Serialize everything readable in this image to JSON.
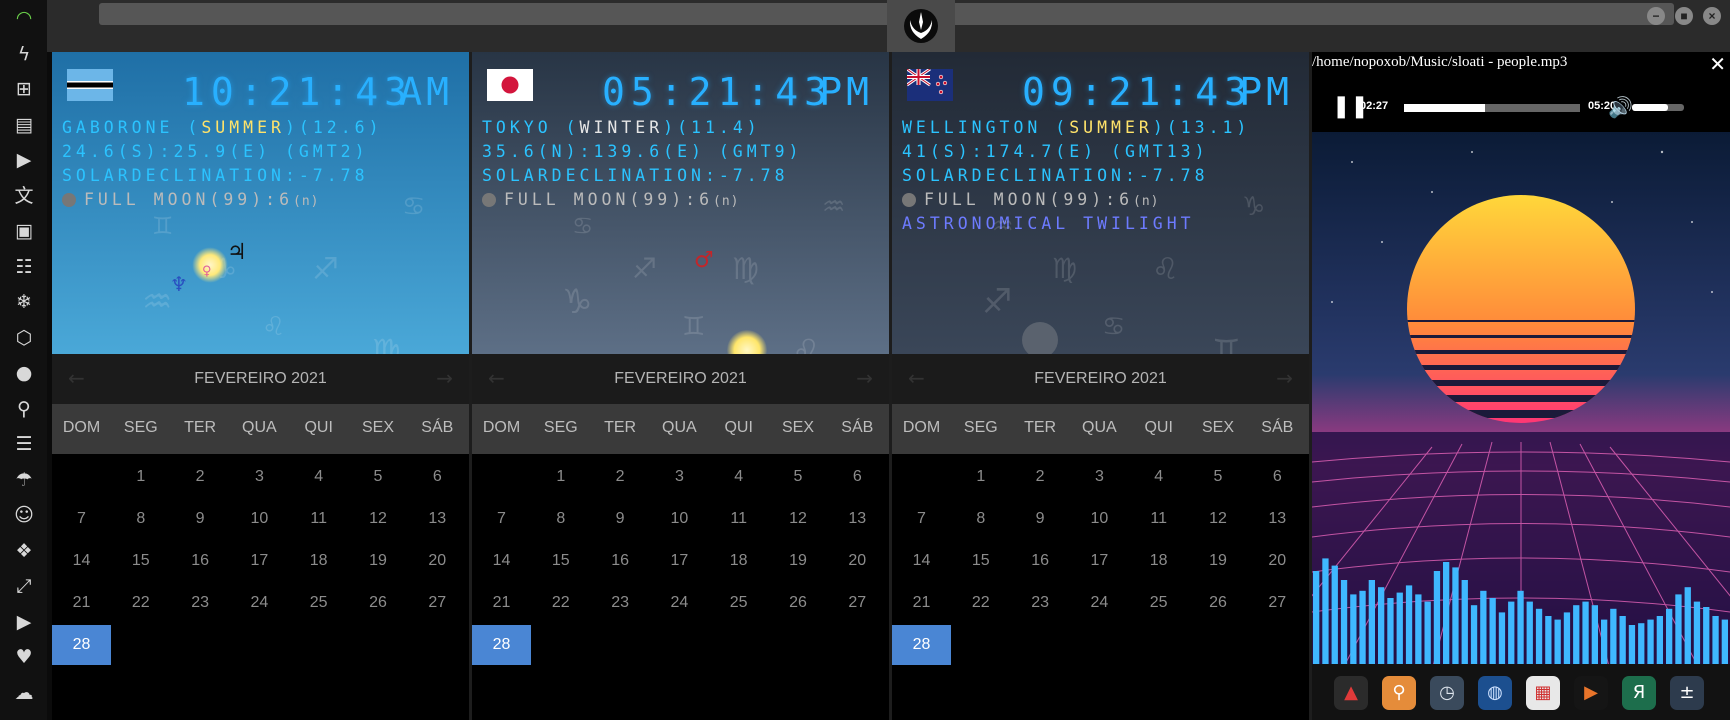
{
  "dock": {
    "items": [
      {
        "icon": "wifi-icon",
        "glyph": "◠"
      },
      {
        "icon": "lightning-icon",
        "glyph": "ϟ"
      },
      {
        "icon": "windows-icon",
        "glyph": "⊞"
      },
      {
        "icon": "archive-icon",
        "glyph": "▤"
      },
      {
        "icon": "play-circle-icon",
        "glyph": "▶"
      },
      {
        "icon": "translate-icon",
        "glyph": "文"
      },
      {
        "icon": "image-icon",
        "glyph": "▣"
      },
      {
        "icon": "news-icon",
        "glyph": "☷"
      },
      {
        "icon": "snowflake-icon",
        "glyph": "❄"
      },
      {
        "icon": "hexagon-icon",
        "glyph": "⬡"
      },
      {
        "icon": "globe-icon",
        "glyph": "●"
      },
      {
        "icon": "search-icon",
        "glyph": "⚲"
      },
      {
        "icon": "map-icon",
        "glyph": "☰"
      },
      {
        "icon": "umbrella-icon",
        "glyph": "☂"
      },
      {
        "icon": "contacts-icon",
        "glyph": "☺"
      },
      {
        "icon": "code-icon",
        "glyph": "❖"
      },
      {
        "icon": "fullscreen-icon",
        "glyph": "⤢"
      },
      {
        "icon": "youtube-icon",
        "glyph": "▶"
      },
      {
        "icon": "heart-icon",
        "glyph": "♥"
      },
      {
        "icon": "cloud-icon",
        "glyph": "☁"
      }
    ]
  },
  "window": {
    "buttons": [
      {
        "name": "minimize-button",
        "glyph": "−"
      },
      {
        "name": "maximize-button",
        "glyph": "■"
      },
      {
        "name": "close-button",
        "glyph": "×"
      }
    ]
  },
  "clocks": [
    {
      "flag": "botswana",
      "time": "10:21:43",
      "ampm": "AM",
      "city": "GABORONE",
      "season": "SUMMER",
      "season_color": "yellow",
      "day_len": "(12.6)",
      "coords": "24.6(S):25.9(E) (GMT2)",
      "solar": "SOLARDECLINATION:-7.78",
      "moon": "FULL MOON(99):6",
      "moon_suffix": "(n)",
      "twilight": "",
      "sky_top": "#1f6fa6",
      "sky_bottom": "#4aa8d8"
    },
    {
      "flag": "japan",
      "time": "05:21:43",
      "ampm": "PM",
      "city": "TOKYO",
      "season": "WINTER",
      "season_color": "white",
      "day_len": "(11.4)",
      "coords": "35.6(N):139.6(E) (GMT9)",
      "solar": "SOLARDECLINATION:-7.78",
      "moon": "FULL MOON(99):6",
      "moon_suffix": "(n)",
      "twilight": "",
      "sky_top": "#283545",
      "sky_bottom": "#5d6f86"
    },
    {
      "flag": "new-zealand",
      "time": "09:21:43",
      "ampm": "PM",
      "city": "WELLINGTON",
      "season": "SUMMER",
      "season_color": "yellow",
      "day_len": "(13.1)",
      "coords": "41(S):174.7(E) (GMT13)",
      "solar": "SOLARDECLINATION:-7.78",
      "moon": "FULL MOON(99):6",
      "moon_suffix": "(n)",
      "twilight": "ASTRONOMICAL TWILIGHT",
      "sky_top": "#222a36",
      "sky_bottom": "#3a4658"
    }
  ],
  "calendar": {
    "title": "FEVEREIRO 2021",
    "weekdays": [
      "DOM",
      "SEG",
      "TER",
      "QUA",
      "QUI",
      "SEX",
      "SÁB"
    ],
    "first_col": 1,
    "days_in_month": 28,
    "selected": 28
  },
  "player": {
    "title": "/home/nopoxob/Music/sloati - people.mp3",
    "close_glyph": "✕",
    "pause_glyph": "❚❚",
    "elapsed": "02:27",
    "duration": "05:20",
    "progress_fraction": 0.46,
    "volume_fraction": 0.7,
    "volume_glyph": "🔊",
    "spectrum": [
      0.55,
      0.62,
      0.58,
      0.5,
      0.42,
      0.44,
      0.5,
      0.46,
      0.4,
      0.43,
      0.47,
      0.42,
      0.38,
      0.55,
      0.6,
      0.57,
      0.5,
      0.36,
      0.44,
      0.4,
      0.32,
      0.38,
      0.44,
      0.38,
      0.34,
      0.3,
      0.28,
      0.32,
      0.36,
      0.38,
      0.36,
      0.28,
      0.34,
      0.3,
      0.25,
      0.26,
      0.28,
      0.3,
      0.34,
      0.42,
      0.46,
      0.38,
      0.35,
      0.3,
      0.28
    ]
  },
  "tray": {
    "items": [
      {
        "icon": "anydesk-icon",
        "glyph": "▲",
        "bg": "#2b2b2b",
        "fg": "#e03a3a"
      },
      {
        "icon": "search-app-icon",
        "glyph": "⚲",
        "bg": "#e58c3a",
        "fg": "#fff"
      },
      {
        "icon": "clock-app-icon",
        "glyph": "◷",
        "bg": "#3a4a5c",
        "fg": "#dfe6ee"
      },
      {
        "icon": "browser-icon",
        "glyph": "◍",
        "bg": "#1c4f8f",
        "fg": "#cfe2ff"
      },
      {
        "icon": "calendar-app-icon",
        "glyph": "▦",
        "bg": "#e8e8e8",
        "fg": "#d03030"
      },
      {
        "icon": "media-play-icon",
        "glyph": "▶",
        "bg": "#151515",
        "fg": "#e8742a"
      },
      {
        "icon": "yandex-icon",
        "glyph": "Я",
        "bg": "#1d6e4c",
        "fg": "#fff"
      },
      {
        "icon": "calculator-icon",
        "glyph": "±",
        "bg": "#2d3b4d",
        "fg": "#fff"
      }
    ]
  }
}
